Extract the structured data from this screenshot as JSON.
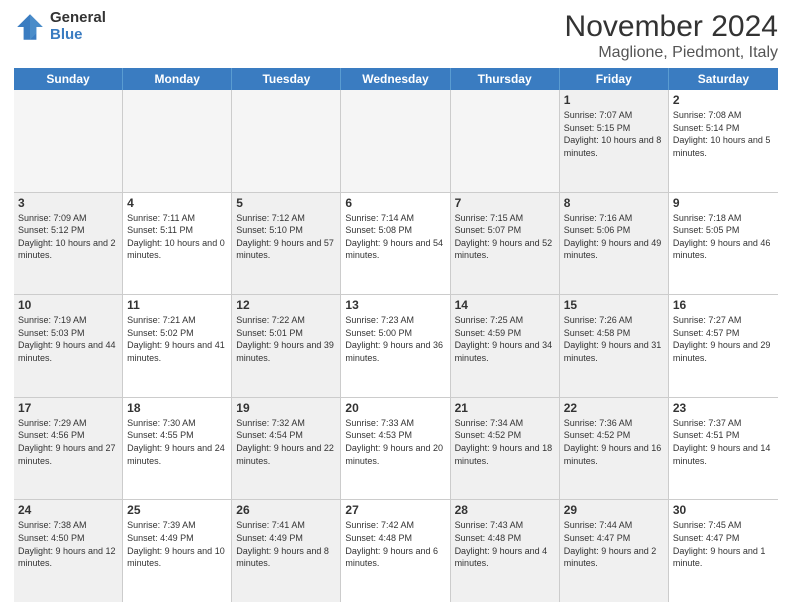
{
  "header": {
    "logo_general": "General",
    "logo_blue": "Blue",
    "month_title": "November 2024",
    "location": "Maglione, Piedmont, Italy"
  },
  "days_of_week": [
    "Sunday",
    "Monday",
    "Tuesday",
    "Wednesday",
    "Thursday",
    "Friday",
    "Saturday"
  ],
  "weeks": [
    [
      {
        "day": "",
        "info": "",
        "empty": true
      },
      {
        "day": "",
        "info": "",
        "empty": true
      },
      {
        "day": "",
        "info": "",
        "empty": true
      },
      {
        "day": "",
        "info": "",
        "empty": true
      },
      {
        "day": "",
        "info": "",
        "empty": true
      },
      {
        "day": "1",
        "info": "Sunrise: 7:07 AM\nSunset: 5:15 PM\nDaylight: 10 hours and 8 minutes.",
        "shaded": true
      },
      {
        "day": "2",
        "info": "Sunrise: 7:08 AM\nSunset: 5:14 PM\nDaylight: 10 hours and 5 minutes."
      }
    ],
    [
      {
        "day": "3",
        "info": "Sunrise: 7:09 AM\nSunset: 5:12 PM\nDaylight: 10 hours and 2 minutes.",
        "shaded": true
      },
      {
        "day": "4",
        "info": "Sunrise: 7:11 AM\nSunset: 5:11 PM\nDaylight: 10 hours and 0 minutes."
      },
      {
        "day": "5",
        "info": "Sunrise: 7:12 AM\nSunset: 5:10 PM\nDaylight: 9 hours and 57 minutes.",
        "shaded": true
      },
      {
        "day": "6",
        "info": "Sunrise: 7:14 AM\nSunset: 5:08 PM\nDaylight: 9 hours and 54 minutes."
      },
      {
        "day": "7",
        "info": "Sunrise: 7:15 AM\nSunset: 5:07 PM\nDaylight: 9 hours and 52 minutes.",
        "shaded": true
      },
      {
        "day": "8",
        "info": "Sunrise: 7:16 AM\nSunset: 5:06 PM\nDaylight: 9 hours and 49 minutes.",
        "shaded": true
      },
      {
        "day": "9",
        "info": "Sunrise: 7:18 AM\nSunset: 5:05 PM\nDaylight: 9 hours and 46 minutes."
      }
    ],
    [
      {
        "day": "10",
        "info": "Sunrise: 7:19 AM\nSunset: 5:03 PM\nDaylight: 9 hours and 44 minutes.",
        "shaded": true
      },
      {
        "day": "11",
        "info": "Sunrise: 7:21 AM\nSunset: 5:02 PM\nDaylight: 9 hours and 41 minutes."
      },
      {
        "day": "12",
        "info": "Sunrise: 7:22 AM\nSunset: 5:01 PM\nDaylight: 9 hours and 39 minutes.",
        "shaded": true
      },
      {
        "day": "13",
        "info": "Sunrise: 7:23 AM\nSunset: 5:00 PM\nDaylight: 9 hours and 36 minutes."
      },
      {
        "day": "14",
        "info": "Sunrise: 7:25 AM\nSunset: 4:59 PM\nDaylight: 9 hours and 34 minutes.",
        "shaded": true
      },
      {
        "day": "15",
        "info": "Sunrise: 7:26 AM\nSunset: 4:58 PM\nDaylight: 9 hours and 31 minutes.",
        "shaded": true
      },
      {
        "day": "16",
        "info": "Sunrise: 7:27 AM\nSunset: 4:57 PM\nDaylight: 9 hours and 29 minutes."
      }
    ],
    [
      {
        "day": "17",
        "info": "Sunrise: 7:29 AM\nSunset: 4:56 PM\nDaylight: 9 hours and 27 minutes.",
        "shaded": true
      },
      {
        "day": "18",
        "info": "Sunrise: 7:30 AM\nSunset: 4:55 PM\nDaylight: 9 hours and 24 minutes."
      },
      {
        "day": "19",
        "info": "Sunrise: 7:32 AM\nSunset: 4:54 PM\nDaylight: 9 hours and 22 minutes.",
        "shaded": true
      },
      {
        "day": "20",
        "info": "Sunrise: 7:33 AM\nSunset: 4:53 PM\nDaylight: 9 hours and 20 minutes."
      },
      {
        "day": "21",
        "info": "Sunrise: 7:34 AM\nSunset: 4:52 PM\nDaylight: 9 hours and 18 minutes.",
        "shaded": true
      },
      {
        "day": "22",
        "info": "Sunrise: 7:36 AM\nSunset: 4:52 PM\nDaylight: 9 hours and 16 minutes.",
        "shaded": true
      },
      {
        "day": "23",
        "info": "Sunrise: 7:37 AM\nSunset: 4:51 PM\nDaylight: 9 hours and 14 minutes."
      }
    ],
    [
      {
        "day": "24",
        "info": "Sunrise: 7:38 AM\nSunset: 4:50 PM\nDaylight: 9 hours and 12 minutes.",
        "shaded": true
      },
      {
        "day": "25",
        "info": "Sunrise: 7:39 AM\nSunset: 4:49 PM\nDaylight: 9 hours and 10 minutes."
      },
      {
        "day": "26",
        "info": "Sunrise: 7:41 AM\nSunset: 4:49 PM\nDaylight: 9 hours and 8 minutes.",
        "shaded": true
      },
      {
        "day": "27",
        "info": "Sunrise: 7:42 AM\nSunset: 4:48 PM\nDaylight: 9 hours and 6 minutes."
      },
      {
        "day": "28",
        "info": "Sunrise: 7:43 AM\nSunset: 4:48 PM\nDaylight: 9 hours and 4 minutes.",
        "shaded": true
      },
      {
        "day": "29",
        "info": "Sunrise: 7:44 AM\nSunset: 4:47 PM\nDaylight: 9 hours and 2 minutes.",
        "shaded": true
      },
      {
        "day": "30",
        "info": "Sunrise: 7:45 AM\nSunset: 4:47 PM\nDaylight: 9 hours and 1 minute."
      }
    ]
  ]
}
